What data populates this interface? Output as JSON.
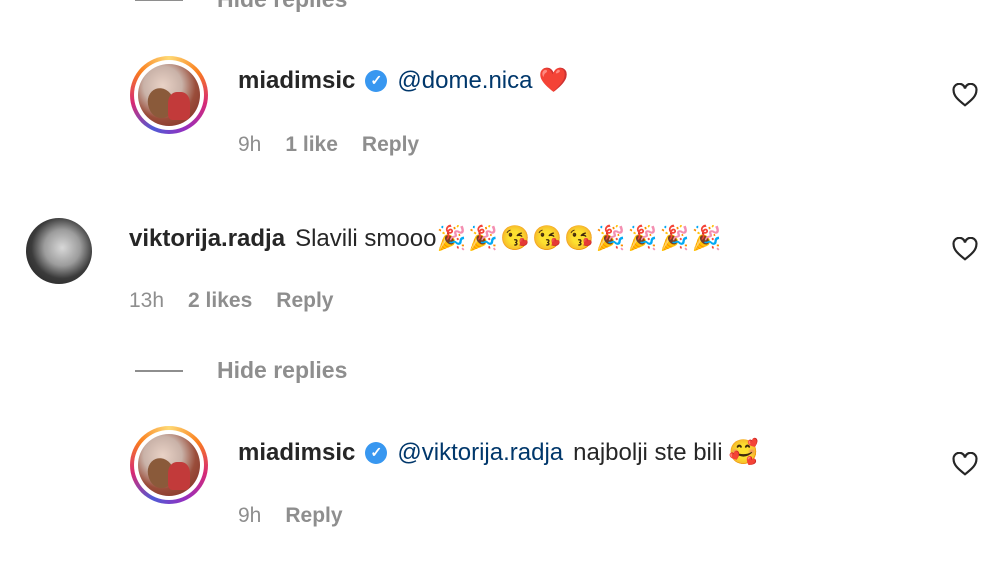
{
  "top_thread": {
    "hide_replies_label": "Hide replies",
    "reply": {
      "username": "miadimsic",
      "mention": "@dome.nica",
      "emoji": "❤️",
      "time": "9h",
      "likes": "1 like",
      "reply_label": "Reply"
    }
  },
  "comment": {
    "username": "viktorija.radja",
    "text": "Slavili smooo",
    "emojis": "🎉🎉😘😘😘🎉🎉🎉🎉",
    "time": "13h",
    "likes": "2 likes",
    "reply_label": "Reply",
    "hide_replies_label": "Hide replies",
    "reply": {
      "username": "miadimsic",
      "mention": "@viktorija.radja",
      "text": "najbolji ste bili",
      "emoji": "🥰",
      "time": "9h",
      "reply_label": "Reply"
    }
  },
  "icons": {
    "verified": "verified-badge-icon",
    "like": "heart-outline-icon"
  },
  "colors": {
    "username": "#262626",
    "mention": "#00376b",
    "meta": "#8e8e8e",
    "verified": "#3897f0"
  }
}
